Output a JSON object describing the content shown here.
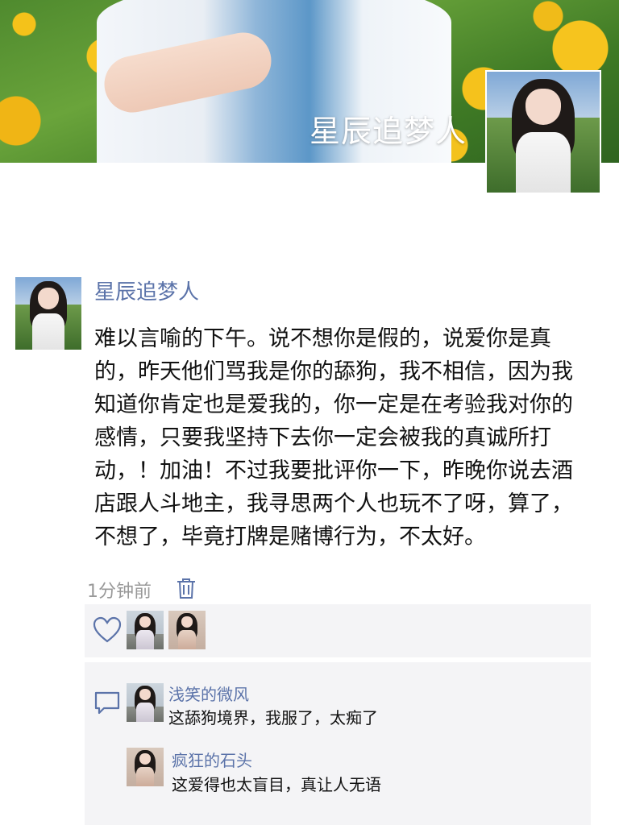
{
  "cover": {
    "name": "星辰追梦人"
  },
  "post": {
    "author": "星辰追梦人",
    "text": "难以言喻的下午。说不想你是假的，说爱你是真的，昨天他们骂我是你的舔狗，我不相信，因为我知道你肯定也是爱我的，你一定是在考验我对你的感情，只要我坚持下去你一定会被我的真诚所打动，！加油！不过我要批评你一下，昨晚你说去酒店跟人斗地主，我寻思两个人也玩不了呀，算了，不想了，毕竟打牌是赌博行为，不太好。",
    "time": "1分钟前"
  },
  "icons": {
    "delete": "trash-icon",
    "like": "heart-icon",
    "comment": "comment-bubble-icon"
  },
  "comments": [
    {
      "name": "浅笑的微风",
      "text": "这舔狗境界，我服了，太痴了"
    },
    {
      "name": "疯狂的石头",
      "text": "这爱得也太盲目，真让人无语"
    }
  ],
  "colors": {
    "link": "#5b73a9",
    "meta": "#999999",
    "panel": "#f4f4f6"
  }
}
